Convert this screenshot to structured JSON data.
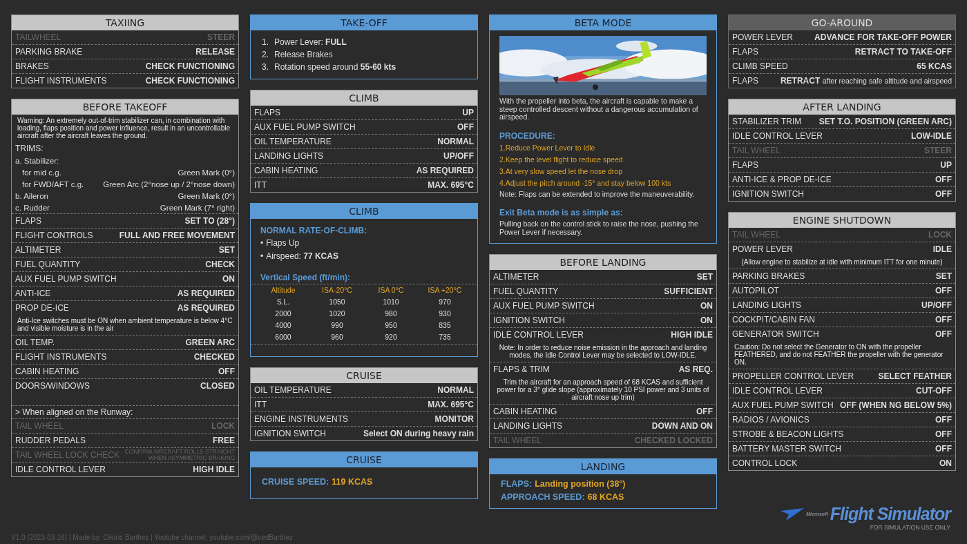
{
  "columns": [
    {
      "cards": [
        {
          "title": "TAXIING",
          "kind": "checklist",
          "rows": [
            {
              "kind": "item",
              "label": "TAILWHEEL",
              "value": "STEER",
              "dim": true
            },
            {
              "kind": "item",
              "label": "PARKING BRAKE",
              "value": "RELEASE",
              "dim": false
            },
            {
              "kind": "item",
              "label": "BRAKES",
              "value": "CHECK FUNCTIONING",
              "dim": false
            },
            {
              "kind": "item",
              "label": "FLIGHT INSTRUMENTS",
              "value": "CHECK FUNCTIONING",
              "dim": false
            }
          ]
        },
        {
          "title": "BEFORE TAKEOFF",
          "kind": "checklist",
          "rows": [
            {
              "kind": "note",
              "text": "Warning: An extremely out-of-trim stabilizer can, in combination with loading, flaps position and power influence, result in an uncontrollable aircraft after the aircraft leaves the ground."
            },
            {
              "kind": "line",
              "text": "TRIMS:"
            },
            {
              "kind": "trim",
              "label": "a. Stabilizer:"
            },
            {
              "kind": "trim-sub",
              "label": "for mid c.g.",
              "value": "Green Mark (0°)"
            },
            {
              "kind": "trim-sub",
              "label": "for FWD/AFT c.g.",
              "value": "Green Arc (2°nose up / 2°nose down)"
            },
            {
              "kind": "trim",
              "label": "b. Aileron",
              "value": "Green Mark (0°)"
            },
            {
              "kind": "trim",
              "label": "c. Rudder",
              "value": "Green Mark (7° right)"
            },
            {
              "kind": "item",
              "label": "FLAPS",
              "value": "SET TO (28°)",
              "dim": false
            },
            {
              "kind": "item",
              "label": "FLIGHT CONTROLS",
              "value": "FULL AND FREE MOVEMENT",
              "dim": false
            },
            {
              "kind": "item",
              "label": "ALTIMETER",
              "value": "SET",
              "dim": false
            },
            {
              "kind": "item",
              "label": "FUEL QUANTITY",
              "value": "CHECK",
              "dim": false
            },
            {
              "kind": "item",
              "label": "AUX FUEL PUMP SWITCH",
              "value": "ON",
              "dim": false
            },
            {
              "kind": "item",
              "label": "ANTI-ICE",
              "value": "AS REQUIRED",
              "dim": false
            },
            {
              "kind": "item",
              "label": "PROP DE-ICE",
              "value": "AS REQUIRED",
              "dim": false
            },
            {
              "kind": "note",
              "text": "Anti-Ice switches must be ON when ambient temperature is below 4°C and visible moisture is in the air"
            },
            {
              "kind": "item",
              "label": "OIL TEMP.",
              "value": "GREEN ARC",
              "dim": false
            },
            {
              "kind": "item",
              "label": "FLIGHT INSTRUMENTS",
              "value": "CHECKED",
              "dim": false
            },
            {
              "kind": "item",
              "label": "CABIN HEATING",
              "value": "OFF",
              "dim": false
            },
            {
              "kind": "item",
              "label": "DOORS/WINDOWS",
              "value": "CLOSED",
              "dim": false
            },
            {
              "kind": "line",
              "text": "> When aligned on the Runway:"
            },
            {
              "kind": "item",
              "label": "TAIL WHEEL",
              "value": "LOCK",
              "dim": true
            },
            {
              "kind": "item",
              "label": "RUDDER PEDALS",
              "value": "FREE",
              "dim": false
            },
            {
              "kind": "item-small",
              "label": "TAIL WHEEL LOCK CHECK",
              "value": "CONFIRM AIRCRAFT ROLLS STRAIGHT WHEN ASYMMETRIC BRAKING",
              "dim": true
            },
            {
              "kind": "item",
              "label": "IDLE CONTROL LEVER",
              "value": "HIGH IDLE",
              "dim": false
            }
          ]
        }
      ]
    },
    {
      "cards": [
        {
          "title": "TAKE-OFF",
          "kind": "procedure",
          "rows": [
            {
              "kind": "step",
              "number": "1.",
              "text": "Power Lever: **FULL**"
            },
            {
              "kind": "step",
              "number": "2.",
              "text": "Release Brakes"
            },
            {
              "kind": "step",
              "number": "3.",
              "text": "Rotation speed around **55-60 kts**"
            }
          ]
        },
        {
          "title": "CLIMB",
          "kind": "checklist",
          "rows": [
            {
              "kind": "item",
              "label": "FLAPS",
              "value": "UP",
              "dim": false
            },
            {
              "kind": "item",
              "label": "AUX FUEL PUMP SWITCH",
              "value": "OFF",
              "dim": false
            },
            {
              "kind": "item",
              "label": "OIL TEMPERATURE",
              "value": "NORMAL",
              "dim": false
            },
            {
              "kind": "item",
              "label": "LANDING LIGHTS",
              "value": "UP/OFF",
              "dim": false
            },
            {
              "kind": "item",
              "label": "CABIN HEATING",
              "value": "AS REQUIRED",
              "dim": false
            },
            {
              "kind": "item",
              "label": "ITT",
              "value": "MAX. 695°C",
              "dim": false
            }
          ]
        },
        {
          "title": "CLIMB",
          "kind": "procedure",
          "rows": [
            {
              "kind": "subhead",
              "text": "NORMAL RATE-OF-CLIMB:"
            },
            {
              "kind": "bullet",
              "marker": "•",
              "text": "Flaps Up"
            },
            {
              "kind": "bullet",
              "marker": "•",
              "text": "Airspeed: **77 KCAS**"
            },
            {
              "kind": "subhead",
              "text": "Vertical Speed (ft/min):"
            },
            {
              "kind": "table",
              "columns": [
                "Altitude",
                "ISA-20°C",
                "ISA 0°C",
                "ISA +20°C"
              ],
              "rows": [
                [
                  "S.L.",
                  "1050",
                  "1010",
                  "970"
                ],
                [
                  "2000",
                  "1020",
                  "980",
                  "930"
                ],
                [
                  "4000",
                  "990",
                  "950",
                  "835"
                ],
                [
                  "6000",
                  "960",
                  "920",
                  "735"
                ]
              ]
            }
          ]
        },
        {
          "title": "CRUISE",
          "kind": "checklist",
          "rows": [
            {
              "kind": "item",
              "label": "OIL TEMPERATURE",
              "value": "NORMAL",
              "dim": false
            },
            {
              "kind": "item",
              "label": "ITT",
              "value": "MAX. 695°C",
              "dim": false
            },
            {
              "kind": "item",
              "label": "ENGINE INSTRUMENTS",
              "value": "MONITOR",
              "dim": false
            },
            {
              "kind": "item",
              "label": "IGNITION SWITCH",
              "value": "Select ON during heavy rain",
              "dim": false
            }
          ]
        },
        {
          "title": "CRUISE",
          "kind": "procedure",
          "rows": [
            {
              "kind": "keyvalue",
              "label": "CRUISE SPEED:",
              "value": "119 KCAS"
            }
          ]
        }
      ]
    },
    {
      "cards": [
        {
          "title": "BETA MODE",
          "kind": "procedure",
          "rows": [
            {
              "kind": "picture"
            },
            {
              "kind": "paragraph",
              "text": "With the propeller into beta, the aircraft is capable to make a steep controlled descent without a dangerous accumulation of airspeed."
            },
            {
              "kind": "subhead",
              "text": "PROCEDURE:"
            },
            {
              "kind": "procedure-step",
              "text": "1.Reduce Power Lever to Idle"
            },
            {
              "kind": "procedure-step",
              "text": "2.Keep the level flight to reduce speed"
            },
            {
              "kind": "procedure-step",
              "text": "3.At very slow speed let the nose drop"
            },
            {
              "kind": "procedure-step",
              "text": "4.Adjust the pitch around -15° and stay below 100 kts"
            },
            {
              "kind": "paragraph",
              "text": "Note: Flaps can be extended to improve the maneuverability."
            },
            {
              "kind": "subhead",
              "text": "Exit Beta mode is as simple as:"
            },
            {
              "kind": "paragraph",
              "text": "Pulling back on the control stick to raise the nose, pushing the Power Lever if necessary."
            }
          ]
        },
        {
          "title": "BEFORE LANDING",
          "kind": "checklist",
          "rows": [
            {
              "kind": "item",
              "label": "ALTIMETER",
              "value": "SET",
              "dim": false
            },
            {
              "kind": "item",
              "label": "FUEL QUANTITY",
              "value": "SUFFICIENT",
              "dim": false
            },
            {
              "kind": "item",
              "label": "AUX FUEL PUMP SWITCH",
              "value": "ON",
              "dim": false
            },
            {
              "kind": "item",
              "label": "IGNITION SWITCH",
              "value": "ON",
              "dim": false
            },
            {
              "kind": "item",
              "label": "IDLE CONTROL LEVER",
              "value": "HIGH IDLE",
              "dim": false
            },
            {
              "kind": "note-center",
              "text": "Note: In order to reduce noise emission in the approach and landing modes, the Idle Control Lever may be selected to LOW-IDLE."
            },
            {
              "kind": "item",
              "label": "FLAPS & TRIM",
              "value": "AS REQ.",
              "dim": false
            },
            {
              "kind": "note-center",
              "text": "Trim the aircraft for an approach speed of 68 KCAS and sufficient power for a 3° glide slope (approximately 10 PSI power and 3 units of aircraft nose up trim)"
            },
            {
              "kind": "item",
              "label": "CABIN HEATING",
              "value": "OFF",
              "dim": false
            },
            {
              "kind": "item",
              "label": "LANDING LIGHTS",
              "value": "DOWN AND ON",
              "dim": false
            },
            {
              "kind": "item",
              "label": "TAIL WHEEL",
              "value": "CHECKED LOCKED",
              "dim": true
            }
          ]
        },
        {
          "title": "LANDING",
          "kind": "procedure",
          "rows": [
            {
              "kind": "keyvalue",
              "label": "FLAPS:",
              "value": "Landing position (38°)"
            },
            {
              "kind": "keyvalue",
              "label": "APPROACH SPEED:",
              "value": "68 KCAS"
            }
          ]
        }
      ]
    },
    {
      "cards": [
        {
          "title": "GO-AROUND",
          "kind": "muted",
          "rows": [
            {
              "kind": "item",
              "label": "POWER LEVER",
              "value": "ADVANCE FOR TAKE-OFF POWER",
              "dim": false
            },
            {
              "kind": "item",
              "label": "FLAPS",
              "value": "RETRACT TO TAKE-OFF",
              "dim": false
            },
            {
              "kind": "item",
              "label": "CLIMB SPEED",
              "value": "65 KCAS",
              "dim": false
            },
            {
              "kind": "item",
              "label": "FLAPS",
              "value": "RETRACT",
              "detail": "after reaching safe altitude and airspeed",
              "dim": false
            }
          ]
        },
        {
          "title": "AFTER LANDING",
          "kind": "checklist",
          "rows": [
            {
              "kind": "item",
              "label": "STABILIZER TRIM",
              "value": "SET T.O. POSITION (GREEN ARC)",
              "dim": false
            },
            {
              "kind": "item",
              "label": "IDLE CONTROL LEVER",
              "value": "LOW-IDLE",
              "dim": false
            },
            {
              "kind": "item",
              "label": "TAIL WHEEL",
              "value": "STEER",
              "dim": true
            },
            {
              "kind": "item",
              "label": "FLAPS",
              "value": "UP",
              "dim": false
            },
            {
              "kind": "item",
              "label": "ANTI-ICE & PROP DE-ICE",
              "value": "OFF",
              "dim": false
            },
            {
              "kind": "item",
              "label": "IGNITION SWITCH",
              "value": "OFF",
              "dim": false
            }
          ]
        },
        {
          "title": "ENGINE SHUTDOWN",
          "kind": "checklist",
          "rows": [
            {
              "kind": "item",
              "label": "TAIL WHEEL",
              "value": "LOCK",
              "dim": true
            },
            {
              "kind": "item",
              "label": "POWER LEVER",
              "value": "IDLE",
              "dim": false
            },
            {
              "kind": "note-center",
              "text": "(Allow engine to stabilize at idle with minimum ITT for one minute)"
            },
            {
              "kind": "item",
              "label": "PARKING BRAKES",
              "value": "SET",
              "dim": false
            },
            {
              "kind": "item",
              "label": "AUTOPILOT",
              "value": "OFF",
              "dim": false
            },
            {
              "kind": "item",
              "label": "LANDING LIGHTS",
              "value": "UP/OFF",
              "dim": false
            },
            {
              "kind": "item",
              "label": "COCKPIT/CABIN FAN",
              "value": "OFF",
              "dim": false
            },
            {
              "kind": "item",
              "label": "GENERATOR SWITCH",
              "value": "OFF",
              "dim": false
            },
            {
              "kind": "note",
              "text": "Caution: Do not select the Generator to ON with the propeller FEATHERED, and do not FEATHER the propeller with the generator ON."
            },
            {
              "kind": "item",
              "label": "PROPELLER CONTROL LEVER",
              "value": "SELECT FEATHER",
              "dim": false
            },
            {
              "kind": "item",
              "label": "IDLE CONTROL LEVER",
              "value": "CUT-OFF",
              "dim": false
            },
            {
              "kind": "item",
              "label": "AUX FUEL PUMP SWITCH",
              "value": "OFF (WHEN NG BELOW 5%)",
              "dim": false
            },
            {
              "kind": "item",
              "label": "RADIOS / AVIONICS",
              "value": "OFF",
              "dim": false
            },
            {
              "kind": "item",
              "label": "STROBE & BEACON LIGHTS",
              "value": "OFF",
              "dim": false
            },
            {
              "kind": "item",
              "label": "BATTERY MASTER SWITCH",
              "value": "OFF",
              "dim": false
            },
            {
              "kind": "item",
              "label": "CONTROL LOCK",
              "value": "ON",
              "dim": false
            }
          ]
        }
      ]
    }
  ],
  "logo": {
    "maker": "Microsoft",
    "name": "Flight Simulator",
    "tagline": "FOR SIMULATION USE ONLY"
  },
  "footer": "V1.0 (2023-03-16) | Made by: Cédric Barthez | Youtube channel: youtube.com/@cedBarthez"
}
